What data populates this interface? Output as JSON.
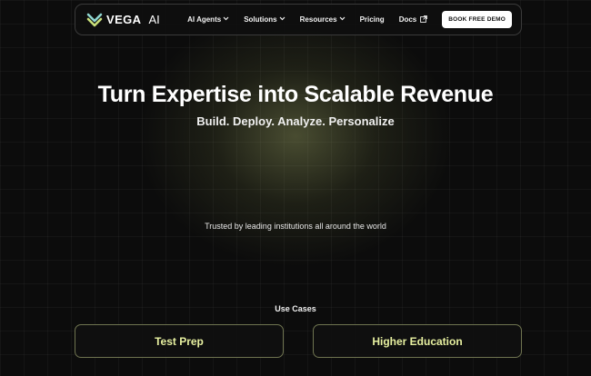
{
  "brand": {
    "name": "VEGA",
    "suffix": "AI",
    "logo_icon": "double-chevron-logo",
    "accent_color": "#e7f0a0"
  },
  "nav": {
    "items": [
      {
        "label": "AI Agents",
        "icon": "chevron-down-icon"
      },
      {
        "label": "Solutions",
        "icon": "chevron-down-icon"
      },
      {
        "label": "Resources",
        "icon": "chevron-down-icon"
      },
      {
        "label": "Pricing"
      },
      {
        "label": "Docs",
        "icon": "external-link-icon"
      }
    ],
    "cta_label": "BOOK FREE DEMO"
  },
  "hero": {
    "title": "Turn Expertise into Scalable Revenue",
    "subtitle": "Build. Deploy. Analyze. Personalize"
  },
  "trusted_text": "Trusted by leading institutions all around the world",
  "use_cases": {
    "label": "Use Cases",
    "cards": [
      {
        "label": "Test Prep"
      },
      {
        "label": "Higher Education"
      }
    ]
  }
}
